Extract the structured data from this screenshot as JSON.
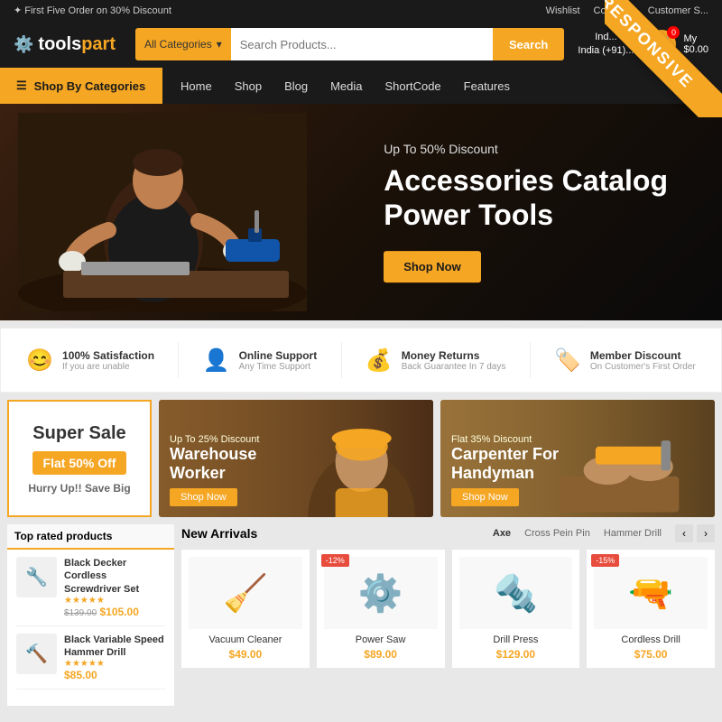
{
  "topbar": {
    "promo": "✦ First Five Order on 30% Discount",
    "links": [
      "Wishlist",
      "Compare",
      "Customer S..."
    ]
  },
  "header": {
    "logo_text_1": "tools",
    "logo_text_2": "part",
    "search_placeholder": "Search Products...",
    "search_category": "All Categories",
    "search_btn": "Search",
    "phone": "India (+91)...",
    "phone_label": "Ind...",
    "cart_label": "My",
    "cart_price": "$0.00"
  },
  "nav": {
    "shop_by": "Shop By Categories",
    "links": [
      "Home",
      "Shop",
      "Blog",
      "Media",
      "ShortCode",
      "Features"
    ]
  },
  "hero": {
    "subtitle": "Up To 50% Discount",
    "title": "Accessories Catalog\nPower Tools",
    "shop_btn": "Shop Now"
  },
  "features": [
    {
      "icon": "😊",
      "title": "100% Satisfaction",
      "desc": "If you are unable"
    },
    {
      "icon": "👤",
      "title": "Online Support",
      "desc": "Any Time Support"
    },
    {
      "icon": "💰",
      "title": "Money Returns",
      "desc": "Back Guarantee In 7 days"
    },
    {
      "icon": "🏷️",
      "title": "Member Discount",
      "desc": "On Customer's First Order"
    }
  ],
  "promo": {
    "sale_title": "Super Sale",
    "sale_flat": "Flat 50% Off",
    "sale_sub": "Hurry Up!! Save Big",
    "banner1_discount": "Up To 25% Discount",
    "banner1_title": "Warehouse\nWorker",
    "banner1_btn": "Shop Now",
    "banner2_discount": "Flat 35% Discount",
    "banner2_title": "Carpenter For\nHandyman",
    "banner2_btn": "Shop Now"
  },
  "top_rated": {
    "title": "Top rated products",
    "products": [
      {
        "name": "Black Decker Cordless Screwdriver Set",
        "price_old": "$139.00",
        "price_new": "$105.00",
        "icon": "🔧"
      },
      {
        "name": "Black Variable Speed Hammer Drill",
        "price_old": "",
        "price_new": "$85.00",
        "icon": "🔨"
      }
    ]
  },
  "new_arrivals": {
    "title": "New Arrivals",
    "tabs": [
      "Axe",
      "Cross Pein Pin",
      "Hammer Drill"
    ],
    "products": [
      {
        "name": "Vacuum Cleaner",
        "price": "$49.00",
        "badge": "",
        "icon": "🧹"
      },
      {
        "name": "Power Saw",
        "price": "$89.00",
        "badge": "-12%",
        "icon": "⚙️"
      },
      {
        "name": "Drill Press",
        "price": "$129.00",
        "badge": "",
        "icon": "🔩"
      },
      {
        "name": "Cordless Drill",
        "price": "$75.00",
        "badge": "-15%",
        "icon": "🔫"
      }
    ]
  },
  "responsive_badge": "RESPONSIVE"
}
